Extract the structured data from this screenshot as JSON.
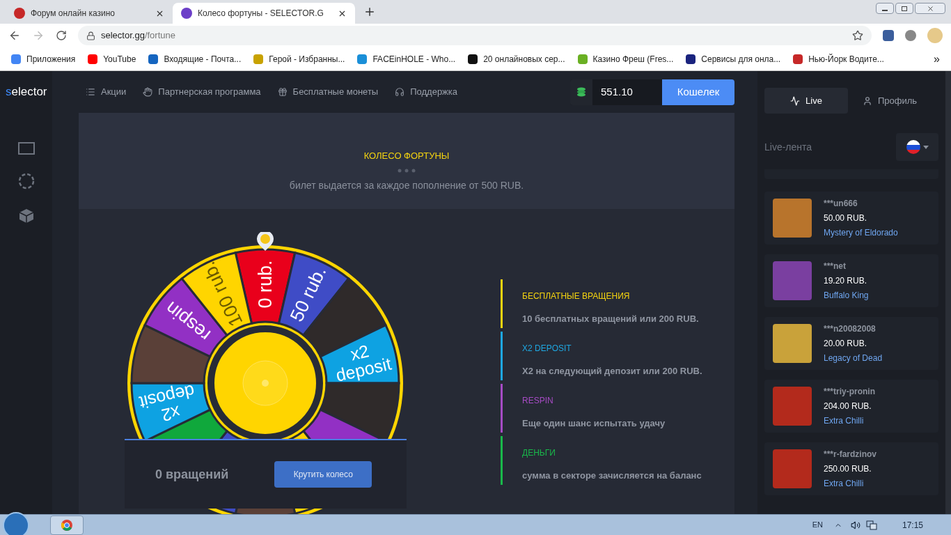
{
  "browser": {
    "tabs": [
      {
        "title": "Форум онлайн казино",
        "selected": false
      },
      {
        "title": "Колесо фортуны - SELECTOR.G",
        "selected": true
      }
    ],
    "address": {
      "host": "selector.gg",
      "path": "/fortune"
    },
    "bookmarks": [
      {
        "label": "Приложения",
        "color": "#4285f4"
      },
      {
        "label": "YouTube",
        "color": "#ff0000"
      },
      {
        "label": "Входящие - Почта...",
        "color": "#1565c0"
      },
      {
        "label": "Герой - Избранны...",
        "color": "#c8a200"
      },
      {
        "label": "FACEinHOLE - Who...",
        "color": "#1a8fd8"
      },
      {
        "label": "20 онлайновых сер...",
        "color": "#111111"
      },
      {
        "label": "Казино Фреш (Fres...",
        "color": "#6ab023"
      },
      {
        "label": "Сервисы для онла...",
        "color": "#1a237e"
      },
      {
        "label": "Нью-Йорк Водите...",
        "color": "#c62828"
      }
    ],
    "more": "»"
  },
  "site": {
    "logo": {
      "accent": "s",
      "rest": "elector"
    },
    "nav": [
      {
        "label": "Акции",
        "kind": "list"
      },
      {
        "label": "Партнерская программа",
        "kind": "hand"
      },
      {
        "label": "Бесплатные монеты",
        "kind": "gift"
      },
      {
        "label": "Поддержка",
        "kind": "headset"
      }
    ],
    "balance": "551.10",
    "wallet_button": "Кошелек"
  },
  "fortune": {
    "title": "КОЛЕСО ФОРТУНЫ",
    "subtitle": "билет выдается за каждое пополнение от 500 RUB.",
    "wheel": {
      "segments": [
        {
          "kind": "text",
          "lines": [
            "0 rub."
          ],
          "color": "#e9001b"
        },
        {
          "kind": "text",
          "lines": [
            "50 rub."
          ],
          "color": "#3f4cc6"
        },
        {
          "kind": "image"
        },
        {
          "kind": "text",
          "lines": [
            "x2",
            "deposit"
          ],
          "color": "#0ea2e2"
        },
        {
          "kind": "image"
        },
        {
          "kind": "text",
          "color": "#9230c4"
        },
        {
          "kind": "text",
          "color": "#ffd500"
        },
        {
          "kind": "image"
        },
        {
          "kind": "text",
          "color": "#3f4cc6"
        },
        {
          "kind": "text",
          "color": "#10a83c"
        },
        {
          "kind": "text",
          "lines": [
            "x2",
            "deposit"
          ],
          "color": "#0ea2e2"
        },
        {
          "kind": "image"
        },
        {
          "kind": "text",
          "lines": [
            "respin"
          ],
          "color": "#9230c4"
        },
        {
          "kind": "text",
          "lines": [
            "100 rub."
          ],
          "color": "#ffd500"
        }
      ]
    },
    "spins": "0 вращений",
    "spin_button": "Крутить колесо",
    "legend": [
      {
        "title": "БЕСПЛАТНЫЕ ВРАЩЕНИЯ",
        "text": "10 бесплатных вращений или 200 RUB.",
        "color": "#f5d40f"
      },
      {
        "title": "X2 DEPOSIT",
        "text": "X2 на следующий депозит или 200 RUB.",
        "color": "#1ea7e1"
      },
      {
        "title": "RESPIN",
        "text": "Еще один шанс испытать удачу",
        "color": "#a64bc4"
      },
      {
        "title": "ДЕНЬГИ",
        "text": "сумма в секторе зачисляется на баланс",
        "color": "#19b84a"
      }
    ]
  },
  "sidebar": {
    "tabs": [
      {
        "label": "Live",
        "selected": true,
        "kind": "live"
      },
      {
        "label": "Профиль",
        "selected": false,
        "kind": "profile"
      }
    ],
    "feed_title": "Live-лента",
    "feed": [
      {
        "user": "***un666",
        "amount": "50.00 RUB.",
        "game": "Mystery of Eldorado"
      },
      {
        "user": "***net",
        "amount": "19.20 RUB.",
        "game": "Buffalo King"
      },
      {
        "user": "***n20082008",
        "amount": "20.00 RUB.",
        "game": "Legacy of Dead"
      },
      {
        "user": "***triy-pronin",
        "amount": "204.00 RUB.",
        "game": "Extra Chilli"
      },
      {
        "user": "***r-fardzinov",
        "amount": "250.00 RUB.",
        "game": "Extra Chilli"
      }
    ]
  },
  "taskbar": {
    "language": "EN",
    "time": "17:15"
  }
}
